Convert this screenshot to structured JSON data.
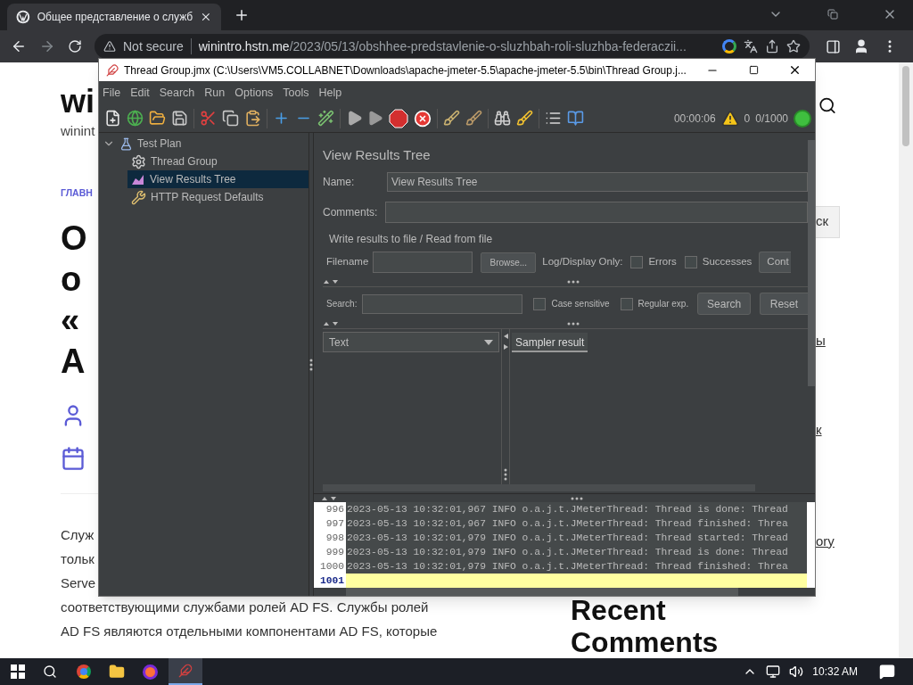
{
  "browser": {
    "tab_title": "Общее представление о служб",
    "url_security": "Not secure",
    "url_host": "winintro.hstn.me",
    "url_path": "/2023/05/13/obshhee-predstavlenie-o-sluzhbah-roli-sluzhba-federaczii..."
  },
  "page": {
    "site_title": "wi",
    "tagline": "winint",
    "category": "ГЛАВН",
    "heading_lines": [
      "О",
      "о",
      "«",
      "A"
    ],
    "body_short": [
      "Служ",
      "тольк",
      "Serve"
    ],
    "body_full": [
      "соответствующими службами ролей AD FS. Службы ролей",
      "AD FS являются отдельными компонентами AD FS, которые"
    ],
    "side_button": "ск",
    "side_links": [
      "ы",
      "к",
      "ory"
    ],
    "side_heading": [
      "Recent",
      "Comments"
    ]
  },
  "jmeter": {
    "title": "Thread Group.jmx (C:\\Users\\VM5.COLLABNET\\Downloads\\apache-jmeter-5.5\\apache-jmeter-5.5\\bin\\Thread Group.j...",
    "menu": [
      "File",
      "Edit",
      "Search",
      "Run",
      "Options",
      "Tools",
      "Help"
    ],
    "timer": "00:00:06",
    "warnings": "0",
    "threads": "0/1000",
    "tree": [
      {
        "label": "Test Plan",
        "kind": "plan",
        "expanded": true,
        "selected": false,
        "children": [
          {
            "label": "Thread Group",
            "kind": "threads",
            "selected": false
          },
          {
            "label": "View Results Tree",
            "kind": "listener",
            "selected": true
          },
          {
            "label": "HTTP Request Defaults",
            "kind": "config",
            "selected": false
          }
        ]
      }
    ],
    "panel": {
      "title": "View Results Tree",
      "name_label": "Name:",
      "name_value": "View Results Tree",
      "comments_label": "Comments:",
      "file_group": "Write results to file / Read from file",
      "filename_label": "Filename",
      "browse": "Browse...",
      "log_only": "Log/Display Only:",
      "filters": [
        {
          "label": "Errors",
          "checked": false
        },
        {
          "label": "Successes",
          "checked": false
        }
      ],
      "configure": "Cont",
      "search_label": "Search:",
      "search_options": [
        {
          "label": "Case sensitive",
          "checked": false
        },
        {
          "label": "Regular exp.",
          "checked": false
        }
      ],
      "search_button": "Search",
      "reset_button": "Reset",
      "renderer": "Text",
      "result_tab": "Sampler result"
    },
    "log": {
      "lines": [
        {
          "number": "996",
          "text": "2023-05-13 10:32:01,967 INFO o.a.j.t.JMeterThread: Thread is done: Thread"
        },
        {
          "number": "997",
          "text": "2023-05-13 10:32:01,967 INFO o.a.j.t.JMeterThread: Thread finished: Threa"
        },
        {
          "number": "998",
          "text": "2023-05-13 10:32:01,979 INFO o.a.j.t.JMeterThread: Thread started: Thread"
        },
        {
          "number": "999",
          "text": "2023-05-13 10:32:01,979 INFO o.a.j.t.JMeterThread: Thread is done: Thread"
        },
        {
          "number": "1000",
          "text": "2023-05-13 10:32:01,979 INFO o.a.j.t.JMeterThread: Thread finished: Threa"
        }
      ],
      "current_line": "1001"
    }
  },
  "taskbar": {
    "clock": "10:32 AM"
  }
}
